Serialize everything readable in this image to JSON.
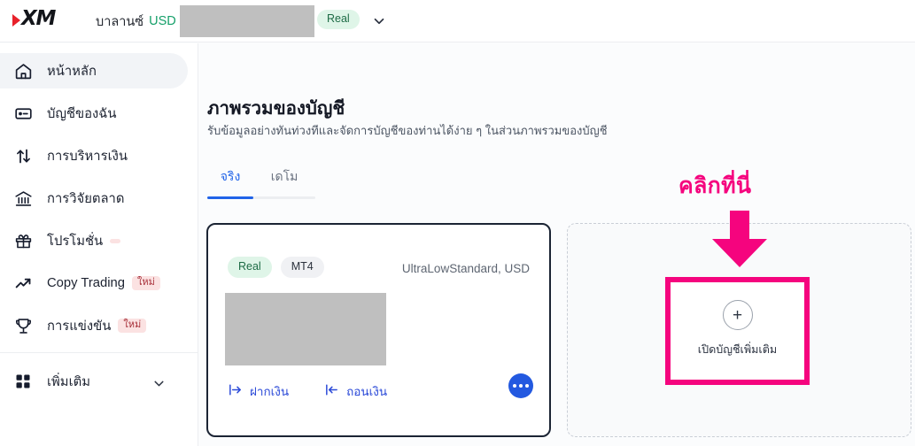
{
  "brand": {
    "logo_text": "XM",
    "logo_accent_color": "#e8212a"
  },
  "topbar": {
    "balance_label": "บาลานซ์",
    "currency": "USD",
    "balance_value_redacted": "",
    "account_type_badge": "Real",
    "chevron_icon": "chevron-down-icon"
  },
  "sidebar": {
    "items": [
      {
        "label": "หน้าหลัก",
        "icon": "home-icon",
        "active": true,
        "badge": ""
      },
      {
        "label": "บัญชีของฉัน",
        "icon": "card-icon",
        "active": false,
        "badge": ""
      },
      {
        "label": "การบริหารเงิน",
        "icon": "transfer-icon",
        "active": false,
        "badge": ""
      },
      {
        "label": "การวิจัยตลาด",
        "icon": "bank-icon",
        "active": false,
        "badge": ""
      },
      {
        "label": "โปรโมชั่น",
        "icon": "gift-icon",
        "active": false,
        "badge": ""
      },
      {
        "label": "Copy Trading",
        "icon": "trending-up-icon",
        "active": false,
        "badge": "ใหม่"
      },
      {
        "label": "การแข่งขัน",
        "icon": "trophy-icon",
        "active": false,
        "badge": "ใหม่"
      }
    ],
    "more": {
      "label": "เพิ่มเติม",
      "icon": "grid-icon",
      "chevron_icon": "chevron-down-icon"
    }
  },
  "main": {
    "title": "ภาพรวมของบัญชี",
    "subtitle": "รับข้อมูลอย่างทันท่วงทีและจัดการบัญชีของท่านได้ง่าย ๆ ในส่วนภาพรวมของบัญชี",
    "tabs": [
      {
        "label": "จริง",
        "active": true
      },
      {
        "label": "เดโม",
        "active": false
      }
    ],
    "account_card": {
      "type_chip": "Real",
      "platform_chip": "MT4",
      "meta": "UltraLowStandard, USD",
      "balance_redacted": "",
      "deposit_label": "ฝากเงิน",
      "deposit_icon": "arrow-into-icon",
      "withdraw_label": "ถอนเงิน",
      "withdraw_icon": "arrow-out-icon",
      "more_icon": "ellipsis-icon"
    },
    "open_account": {
      "plus_icon": "plus-icon",
      "label": "เปิดบัญชีเพิ่มเติม"
    },
    "annotation": {
      "text": "คลิกที่นี่",
      "color": "#f5047e",
      "arrow_icon": "down-arrow-icon"
    }
  }
}
